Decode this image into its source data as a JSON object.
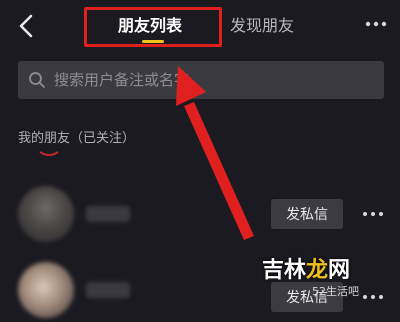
{
  "header": {
    "back_icon": "chevron-left-icon",
    "tabs": [
      {
        "label": "朋友列表",
        "active": true
      },
      {
        "label": "发现朋友",
        "active": false
      }
    ],
    "more_icon": "more-horizontal-icon"
  },
  "search": {
    "placeholder": "搜索用户备注或名字",
    "icon": "search-icon"
  },
  "friends_section": {
    "title": "我的朋友（已关注）",
    "items": [
      {
        "button_label": "发私信"
      },
      {
        "button_label": "发私信"
      }
    ]
  },
  "annotation": {
    "highlight_color": "#e0201e"
  },
  "watermark": {
    "text_main": "吉林",
    "text_accent": "龙",
    "text_end": "网",
    "sub": "52生活吧"
  },
  "colors": {
    "background": "#1a1a20",
    "accent": "#f2c21b",
    "search_bg": "#3a3a40"
  }
}
